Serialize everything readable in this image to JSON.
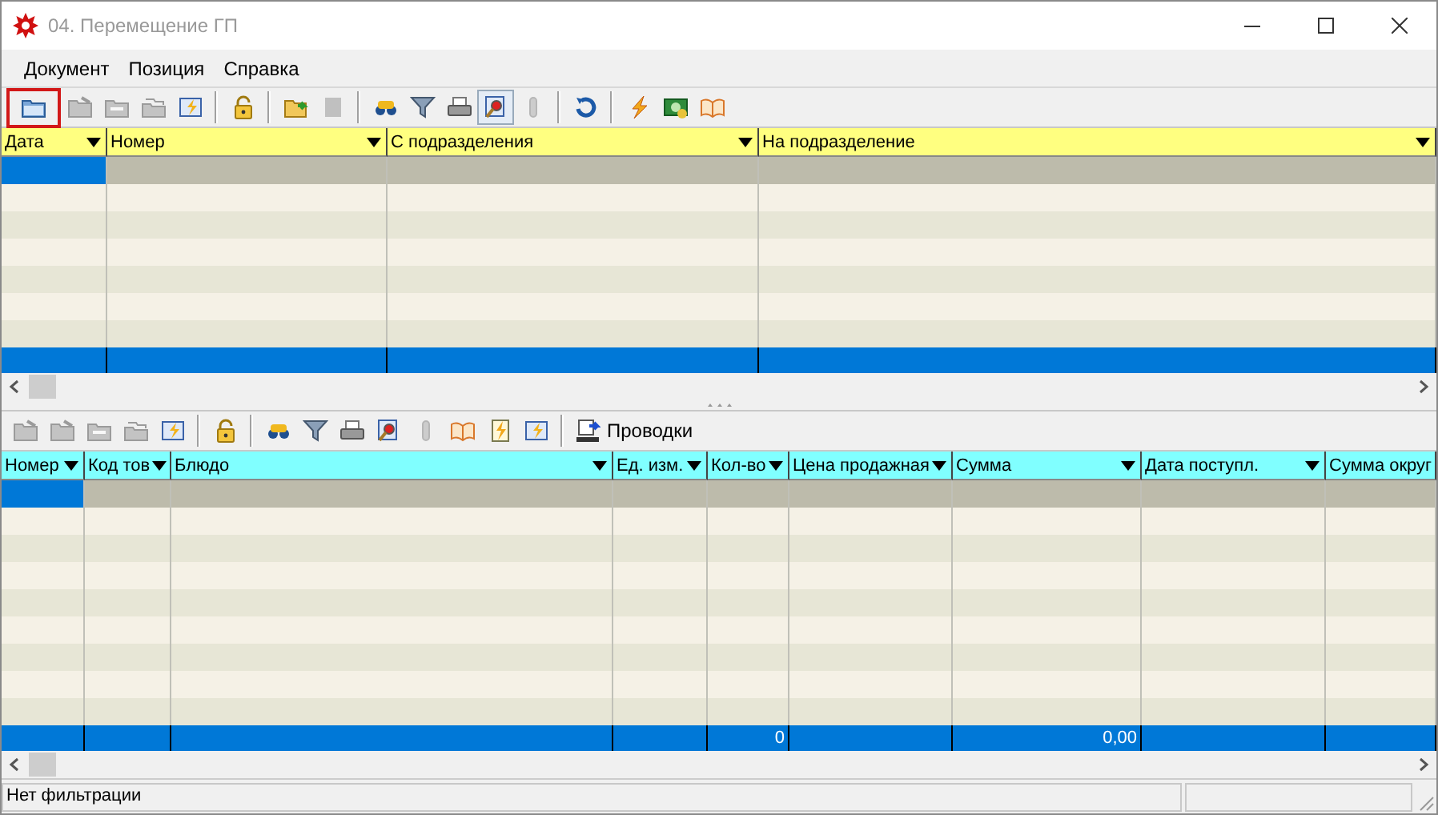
{
  "window": {
    "title": "04. Перемещение ГП"
  },
  "menu": [
    {
      "label": "Документ"
    },
    {
      "label": "Позиция"
    },
    {
      "label": "Справка"
    }
  ],
  "top_toolbar": [
    {
      "kind": "button",
      "disabled": false,
      "selected": true
    },
    {
      "kind": "button",
      "disabled": true,
      "selected": false
    },
    {
      "kind": "button",
      "disabled": true,
      "selected": false
    },
    {
      "kind": "button",
      "disabled": true,
      "selected": false
    },
    {
      "kind": "button",
      "disabled": false,
      "selected": false
    },
    {
      "kind": "separator"
    },
    {
      "kind": "button",
      "disabled": false,
      "selected": false
    },
    {
      "kind": "separator"
    },
    {
      "kind": "button",
      "disabled": false,
      "selected": false
    },
    {
      "kind": "button",
      "disabled": true,
      "selected": false
    },
    {
      "kind": "separator"
    },
    {
      "kind": "button",
      "disabled": false,
      "selected": false
    },
    {
      "kind": "button",
      "disabled": false,
      "selected": false
    },
    {
      "kind": "button",
      "disabled": false,
      "selected": false
    },
    {
      "kind": "button",
      "disabled": false,
      "selected": true
    },
    {
      "kind": "button",
      "disabled": true,
      "selected": false
    },
    {
      "kind": "separator"
    },
    {
      "kind": "button",
      "disabled": false,
      "selected": false
    },
    {
      "kind": "separator"
    },
    {
      "kind": "button",
      "disabled": false,
      "selected": false
    },
    {
      "kind": "button",
      "disabled": false,
      "selected": false
    },
    {
      "kind": "button",
      "disabled": false,
      "selected": false
    }
  ],
  "top_table": {
    "columns": [
      {
        "label": "Дата",
        "sortable": true
      },
      {
        "label": "Номер",
        "sortable": true
      },
      {
        "label": "С подразделения",
        "sortable": true
      },
      {
        "label": "На подразделение",
        "sortable": true
      }
    ],
    "rows": [
      {
        "selected": true
      },
      {
        "selected": false
      },
      {
        "selected": false
      },
      {
        "selected": false
      },
      {
        "selected": false
      },
      {
        "selected": false
      },
      {
        "selected": false
      }
    ],
    "footer_visible": true
  },
  "bottom_toolbar": [
    {
      "kind": "button",
      "disabled": true,
      "selected": false
    },
    {
      "kind": "button",
      "disabled": true,
      "selected": false
    },
    {
      "kind": "button",
      "disabled": true,
      "selected": false
    },
    {
      "kind": "button",
      "disabled": true,
      "selected": false
    },
    {
      "kind": "button",
      "disabled": false,
      "selected": false
    },
    {
      "kind": "separator"
    },
    {
      "kind": "button",
      "disabled": false,
      "selected": false
    },
    {
      "kind": "separator"
    },
    {
      "kind": "button",
      "disabled": false,
      "selected": false
    },
    {
      "kind": "button",
      "disabled": false,
      "selected": false
    },
    {
      "kind": "button",
      "disabled": false,
      "selected": false
    },
    {
      "kind": "button",
      "disabled": false,
      "selected": false
    },
    {
      "kind": "button",
      "disabled": true,
      "selected": false
    },
    {
      "kind": "button",
      "disabled": false,
      "selected": false
    },
    {
      "kind": "button",
      "disabled": false,
      "selected": false
    },
    {
      "kind": "button",
      "disabled": false,
      "selected": false
    },
    {
      "kind": "separator"
    },
    {
      "kind": "text_button",
      "label": "Проводки",
      "disabled": false,
      "selected": false
    }
  ],
  "bottom_table": {
    "columns": [
      {
        "label": "Номер",
        "sortable": true
      },
      {
        "label": "Код тов",
        "sortable": true
      },
      {
        "label": "Блюдо",
        "sortable": true
      },
      {
        "label": "Ед. изм.",
        "sortable": true
      },
      {
        "label": "Кол-во",
        "sortable": true,
        "total": "0"
      },
      {
        "label": "Цена продажная",
        "sortable": true
      },
      {
        "label": "Сумма",
        "sortable": true,
        "total": "0,00"
      },
      {
        "label": "Дата поступл.",
        "sortable": true
      },
      {
        "label": "Сумма округ",
        "sortable": false
      }
    ],
    "rows": [
      {
        "selected": true
      },
      {
        "selected": false
      },
      {
        "selected": false
      },
      {
        "selected": false
      },
      {
        "selected": false
      },
      {
        "selected": false
      },
      {
        "selected": false
      },
      {
        "selected": false
      },
      {
        "selected": false
      }
    ],
    "footer_visible": true
  },
  "status_bar": {
    "text": "Нет фильтрации"
  }
}
